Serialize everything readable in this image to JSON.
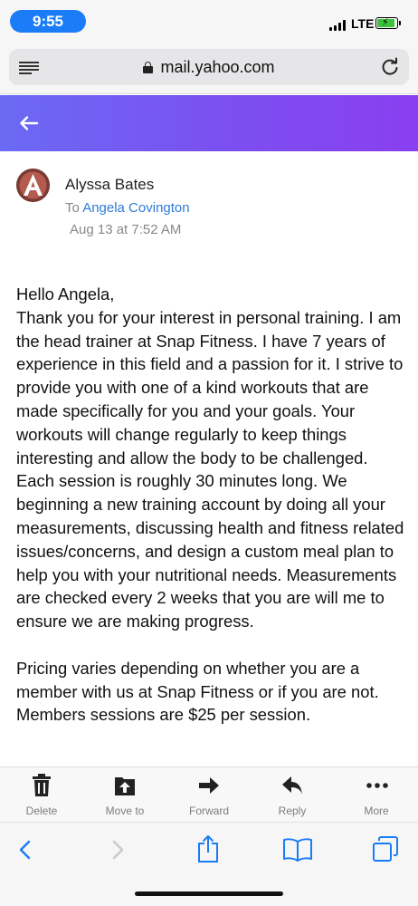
{
  "status": {
    "time": "9:55",
    "network": "LTE"
  },
  "browser": {
    "url": "mail.yahoo.com"
  },
  "email": {
    "sender_name": "Alyssa Bates",
    "to_prefix": "To",
    "to_name": "Angela Covington",
    "date": "Aug 13 at 7:52 AM",
    "avatar_letter": "A",
    "body": "Hello Angela,\nThank you for your interest in personal training. I am the head trainer at Snap Fitness. I have 7 years of experience in this field and a passion for it. I strive to provide you with one of a kind workouts that are made specifically for you and your goals. Your workouts will change regularly to keep things interesting and allow the body to be challenged. Each session is roughly 30 minutes long. We beginning a new training account by doing all your measurements, discussing health and fitness related issues/concerns, and design a custom meal plan to help you with your nutritional needs. Measurements are checked every 2 weeks that you are will me to ensure we are making progress.\n\nPricing varies depending on whether you are a member with us at Snap Fitness or if you are not. Members sessions are $25 per session."
  },
  "toolbar": {
    "delete": "Delete",
    "move_to": "Move to",
    "forward": "Forward",
    "reply": "Reply",
    "more": "More"
  },
  "colors": {
    "header_gradient_start": "#6b6af4",
    "header_gradient_end": "#8a3ff0",
    "link_blue": "#2f7bd8",
    "safari_blue": "#1a7cf6"
  }
}
